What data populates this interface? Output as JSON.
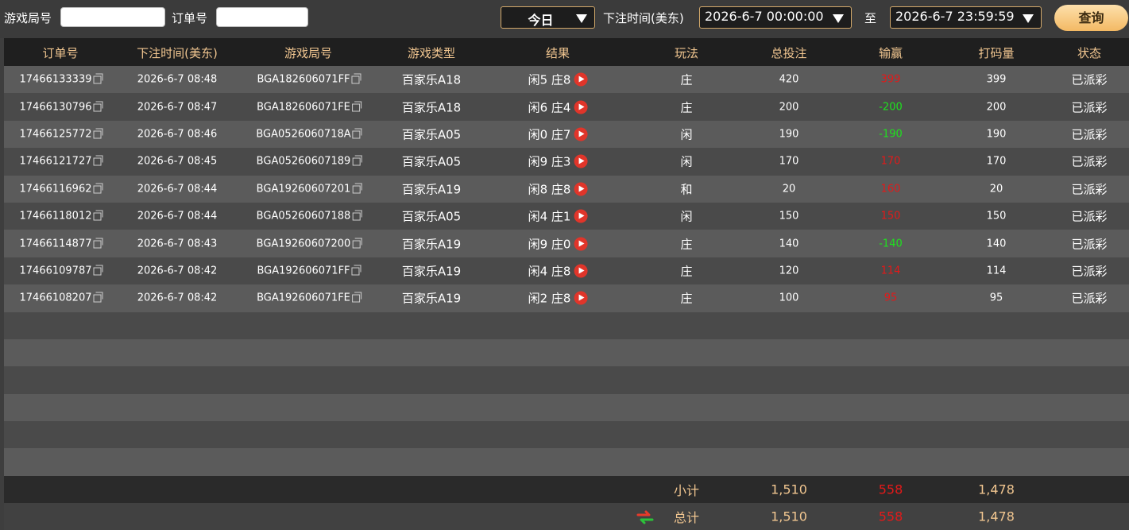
{
  "filters": {
    "game_round_label": "游戏局号",
    "game_round_value": "",
    "order_no_label": "订单号",
    "order_no_value": "",
    "period_select": "今日",
    "time_label": "下注时间(美东)",
    "start_time": "2026-6-7 00:00:00",
    "to_label": "至",
    "end_time": "2026-6-7 23:59:59",
    "query_button": "查询"
  },
  "columns": [
    "订单号",
    "下注时间(美东)",
    "游戏局号",
    "游戏类型",
    "结果",
    "玩法",
    "总投注",
    "输赢",
    "打码量",
    "状态"
  ],
  "rows": [
    {
      "order": "17466133339",
      "time": "2026-6-7 08:48",
      "round": "BGA182606071FF",
      "game": "百家乐A18",
      "result": "闲5 庄8",
      "bet": "庄",
      "total": "420",
      "winloss": "399",
      "wl_color": "red",
      "turnover": "399",
      "status": "已派彩"
    },
    {
      "order": "17466130796",
      "time": "2026-6-7 08:47",
      "round": "BGA182606071FE",
      "game": "百家乐A18",
      "result": "闲6 庄4",
      "bet": "庄",
      "total": "200",
      "winloss": "-200",
      "wl_color": "green",
      "turnover": "200",
      "status": "已派彩"
    },
    {
      "order": "17466125772",
      "time": "2026-6-7 08:46",
      "round": "BGA0526060718A",
      "game": "百家乐A05",
      "result": "闲0 庄7",
      "bet": "闲",
      "total": "190",
      "winloss": "-190",
      "wl_color": "green",
      "turnover": "190",
      "status": "已派彩"
    },
    {
      "order": "17466121727",
      "time": "2026-6-7 08:45",
      "round": "BGA05260607189",
      "game": "百家乐A05",
      "result": "闲9 庄3",
      "bet": "闲",
      "total": "170",
      "winloss": "170",
      "wl_color": "red",
      "turnover": "170",
      "status": "已派彩"
    },
    {
      "order": "17466116962",
      "time": "2026-6-7 08:44",
      "round": "BGA19260607201",
      "game": "百家乐A19",
      "result": "闲8 庄8",
      "bet": "和",
      "total": "20",
      "winloss": "160",
      "wl_color": "red",
      "turnover": "20",
      "status": "已派彩"
    },
    {
      "order": "17466118012",
      "time": "2026-6-7 08:44",
      "round": "BGA05260607188",
      "game": "百家乐A05",
      "result": "闲4 庄1",
      "bet": "闲",
      "total": "150",
      "winloss": "150",
      "wl_color": "red",
      "turnover": "150",
      "status": "已派彩"
    },
    {
      "order": "17466114877",
      "time": "2026-6-7 08:43",
      "round": "BGA19260607200",
      "game": "百家乐A19",
      "result": "闲9 庄0",
      "bet": "庄",
      "total": "140",
      "winloss": "-140",
      "wl_color": "green",
      "turnover": "140",
      "status": "已派彩"
    },
    {
      "order": "17466109787",
      "time": "2026-6-7 08:42",
      "round": "BGA192606071FF",
      "game": "百家乐A19",
      "result": "闲4 庄8",
      "bet": "庄",
      "total": "120",
      "winloss": "114",
      "wl_color": "red",
      "turnover": "114",
      "status": "已派彩"
    },
    {
      "order": "17466108207",
      "time": "2026-6-7 08:42",
      "round": "BGA192606071FE",
      "game": "百家乐A19",
      "result": "闲2 庄8",
      "bet": "庄",
      "total": "100",
      "winloss": "95",
      "wl_color": "red",
      "turnover": "95",
      "status": "已派彩"
    }
  ],
  "subtotal": {
    "label": "小计",
    "total": "1,510",
    "winloss": "558",
    "turnover": "1,478"
  },
  "grand_total": {
    "label": "总计",
    "total": "1,510",
    "winloss": "558",
    "turnover": "1,478"
  },
  "icons": {
    "copy": "copy-icon",
    "play": "play-icon",
    "refresh": "refresh-icon",
    "caret": "caret-down-icon"
  },
  "colors": {
    "accent": "#f1c690",
    "win": "#e31919",
    "loss": "#1ee21e",
    "button": "#f3b964"
  }
}
